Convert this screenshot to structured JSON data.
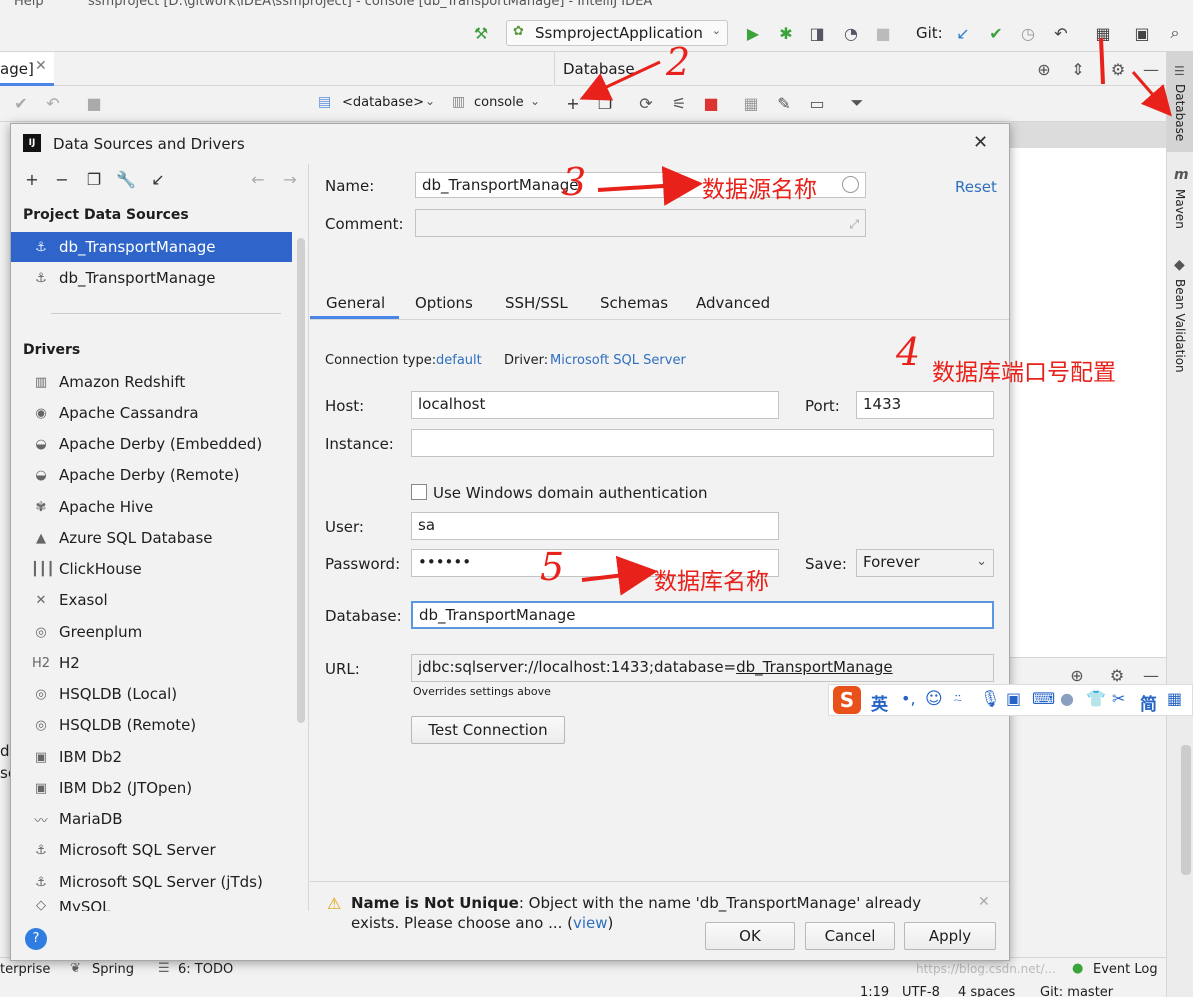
{
  "window": {
    "title_partial": "ssmproject [D:\\gitwork\\IDEA\\ssmproject] - console [db_TransportManage] - IntelliJ IDEA",
    "menu_help": "Help"
  },
  "toolbar": {
    "run_config": "SsmprojectApplication",
    "git_label": "Git:"
  },
  "editor_tab": {
    "label": "age]"
  },
  "database_panel": {
    "title": "Database",
    "db_selector": "<database>",
    "console_selector": "console"
  },
  "right_strip": {
    "database": "Database",
    "maven": "Maven",
    "bean_validation": "Bean Validation"
  },
  "dialog": {
    "title": "Data Sources and Drivers",
    "project_sources_header": "Project Data Sources",
    "project_sources": [
      {
        "label": "db_TransportManage",
        "selected": true
      },
      {
        "label": "db_TransportManage",
        "selected": false
      }
    ],
    "drivers_header": "Drivers",
    "drivers": [
      {
        "label": "Amazon Redshift",
        "icon": "redshift-icon"
      },
      {
        "label": "Apache Cassandra",
        "icon": "cassandra-icon"
      },
      {
        "label": "Apache Derby (Embedded)",
        "icon": "derby-icon"
      },
      {
        "label": "Apache Derby (Remote)",
        "icon": "derby-icon"
      },
      {
        "label": "Apache Hive",
        "icon": "hive-icon"
      },
      {
        "label": "Azure SQL Database",
        "icon": "azure-icon"
      },
      {
        "label": "ClickHouse",
        "icon": "clickhouse-icon"
      },
      {
        "label": "Exasol",
        "icon": "exasol-icon"
      },
      {
        "label": "Greenplum",
        "icon": "greenplum-icon"
      },
      {
        "label": "H2",
        "icon": "h2-icon"
      },
      {
        "label": "HSQLDB (Local)",
        "icon": "hsqldb-icon"
      },
      {
        "label": "HSQLDB (Remote)",
        "icon": "hsqldb-icon"
      },
      {
        "label": "IBM Db2",
        "icon": "db2-icon"
      },
      {
        "label": "IBM Db2 (JTOpen)",
        "icon": "db2-icon"
      },
      {
        "label": "MariaDB",
        "icon": "mariadb-icon"
      },
      {
        "label": "Microsoft SQL Server",
        "icon": "mssql-icon"
      },
      {
        "label": "Microsoft SQL Server (jTds)",
        "icon": "mssql-icon"
      },
      {
        "label": "MySQL",
        "icon": "mysql-icon"
      }
    ],
    "name_label": "Name:",
    "name_value": "db_TransportManage",
    "comment_label": "Comment:",
    "reset_link": "Reset",
    "tabs": [
      "General",
      "Options",
      "SSH/SSL",
      "Schemas",
      "Advanced"
    ],
    "connection_type_label": "Connection type:",
    "connection_type_value": "default",
    "driver_label": "Driver:",
    "driver_value": "Microsoft SQL Server",
    "host_label": "Host:",
    "host_value": "localhost",
    "port_label": "Port:",
    "port_value": "1433",
    "instance_label": "Instance:",
    "instance_value": "",
    "windows_auth_label": "Use Windows domain authentication",
    "user_label": "User:",
    "user_value": "sa",
    "password_label": "Password:",
    "password_value": "••••••",
    "save_label": "Save:",
    "save_value": "Forever",
    "database_label": "Database:",
    "database_value": "db_TransportManage",
    "url_label": "URL:",
    "url_prefix": "jdbc:sqlserver://localhost:1433;database=",
    "url_db": "db_TransportManage",
    "url_hint": "Overrides settings above",
    "test_connection": "Test Connection",
    "warning_title": "Name is Not Unique",
    "warning_text_1": ": Object with the name 'db_TransportManage' already",
    "warning_text_2": "exists. Please choose ano ... (",
    "warning_view": "view",
    "warning_close": ")",
    "ok": "OK",
    "cancel": "Cancel",
    "apply": "Apply",
    "help": "?"
  },
  "annotations": {
    "n1": "1",
    "n2": "2",
    "n3": "3",
    "n4": "4",
    "n5": "5",
    "name_note": "数据源名称",
    "port_note": "数据库端口号配置",
    "db_note": "数据库名称"
  },
  "ime_bar": {
    "logo": "S",
    "lang": "英",
    "simplified": "简"
  },
  "status_bar": {
    "enterprise": "terprise",
    "spring": "Spring",
    "todo": "6: TODO",
    "event_log": "Event Log",
    "position": "1:19",
    "encoding": "UTF-8",
    "indent": "4 spaces",
    "git": "Git: master",
    "watermark": "https://blog.csdn.net/..."
  },
  "side_text": {
    "d": "d",
    "se": "se"
  }
}
